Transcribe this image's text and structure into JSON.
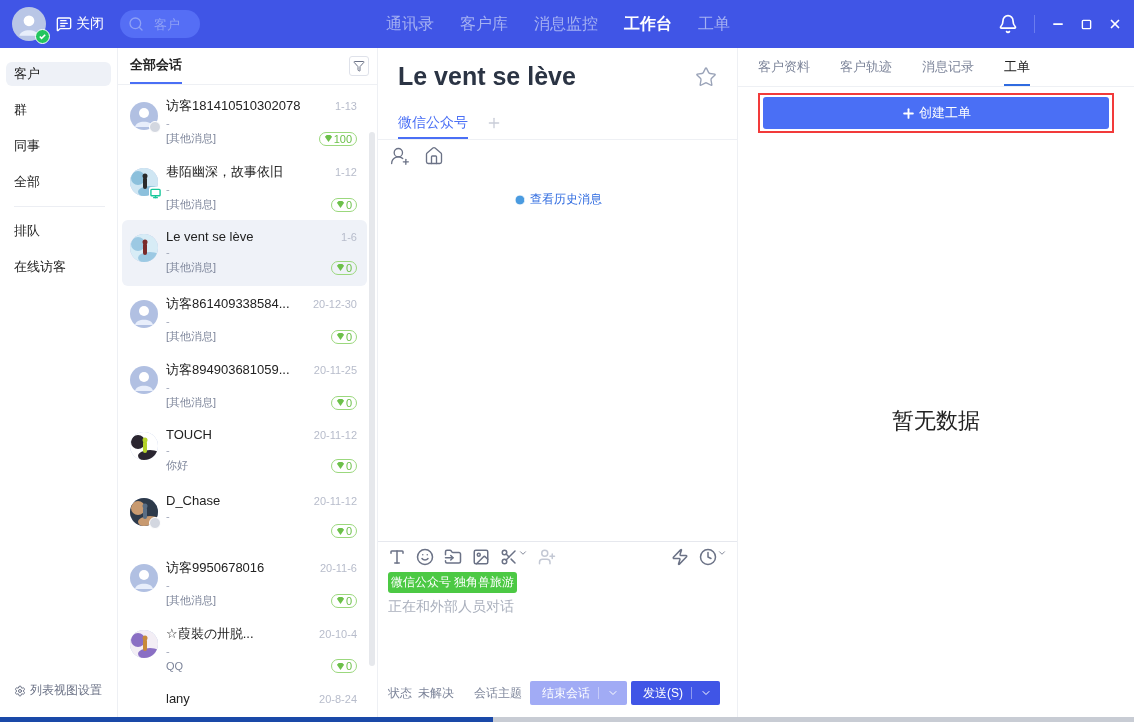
{
  "header": {
    "close_label": "关闭",
    "search": {
      "placeholder": "客户"
    },
    "nav": [
      {
        "label": "通讯录",
        "selected": false
      },
      {
        "label": "客户库",
        "selected": false
      },
      {
        "label": "消息监控",
        "selected": false
      },
      {
        "label": "工作台",
        "selected": true
      },
      {
        "label": "工单",
        "selected": false
      }
    ]
  },
  "sidebar": {
    "items": [
      {
        "label": "客户",
        "selected": true
      },
      {
        "label": "群",
        "selected": false
      },
      {
        "label": "同事",
        "selected": false
      },
      {
        "label": "全部",
        "selected": false
      }
    ],
    "more_items": [
      {
        "label": "排队",
        "selected": false
      },
      {
        "label": "在线访客",
        "selected": false
      }
    ],
    "footer": "列表视图设置"
  },
  "conversations": {
    "title": "全部会话",
    "items": [
      {
        "name": "访客181410510302078",
        "subtitle": "-",
        "preview": "[其他消息]",
        "time": "1-13",
        "badge": "100",
        "kind": "default",
        "offline": true,
        "on_pc": false,
        "selected": false
      },
      {
        "name": "巷陌幽深，故事依旧",
        "subtitle": "-",
        "preview": "[其他消息]",
        "time": "1-12",
        "badge": "0",
        "offline": false,
        "on_pc": true,
        "selected": false
      },
      {
        "name": "Le vent se lève",
        "subtitle": "-",
        "preview": "[其他消息]",
        "time": "1-6",
        "badge": "0",
        "offline": false,
        "on_pc": false,
        "selected": true
      },
      {
        "name": "访客861409338584...",
        "subtitle": "-",
        "preview": "[其他消息]",
        "time": "20-12-30",
        "badge": "0",
        "kind": "default",
        "offline": false,
        "on_pc": false,
        "selected": false
      },
      {
        "name": "访客894903681059...",
        "subtitle": "-",
        "preview": "[其他消息]",
        "time": "20-11-25",
        "badge": "0",
        "kind": "default",
        "offline": false,
        "on_pc": false,
        "selected": false
      },
      {
        "name": "TOUCH",
        "subtitle": "-",
        "preview": "你好",
        "time": "20-11-12",
        "badge": "0",
        "offline": false,
        "on_pc": false,
        "selected": false
      },
      {
        "name": "D_Chase",
        "subtitle": "-",
        "time": "20-11-12",
        "badge": "0",
        "offline": true,
        "on_pc": false,
        "selected": false
      },
      {
        "name": "访客9950678016",
        "subtitle": "-",
        "preview": "[其他消息]",
        "time": "20-11-6",
        "badge": "0",
        "kind": "default",
        "offline": false,
        "on_pc": false,
        "selected": false
      },
      {
        "name": "☆葭裝の卅脱...",
        "subtitle": "-",
        "preview": "QQ",
        "time": "20-10-4",
        "badge": "0",
        "offline": false,
        "on_pc": false,
        "selected": false
      },
      {
        "name": "lany",
        "time": "20-8-24",
        "selected": false
      }
    ]
  },
  "chat": {
    "title": "Le vent se lève",
    "channels": [
      {
        "label": "微信公众号",
        "selected": true
      }
    ],
    "history_link": "查看历史消息",
    "channel_tag": "微信公众号 独角兽旅游",
    "placeholder": "正在和外部人员对话",
    "status_label": "状态",
    "status_value": "未解决",
    "topic": "会话主题",
    "end_button": "结束会话",
    "send_button": "发送(S)"
  },
  "detail": {
    "tabs": [
      {
        "label": "客户资料",
        "selected": false
      },
      {
        "label": "客户轨迹",
        "selected": false
      },
      {
        "label": "消息记录",
        "selected": false
      },
      {
        "label": "工单",
        "selected": true
      }
    ],
    "create_button": "创建工单",
    "empty_text": "暂无数据"
  },
  "progress_bar": {
    "level": 0.435
  }
}
